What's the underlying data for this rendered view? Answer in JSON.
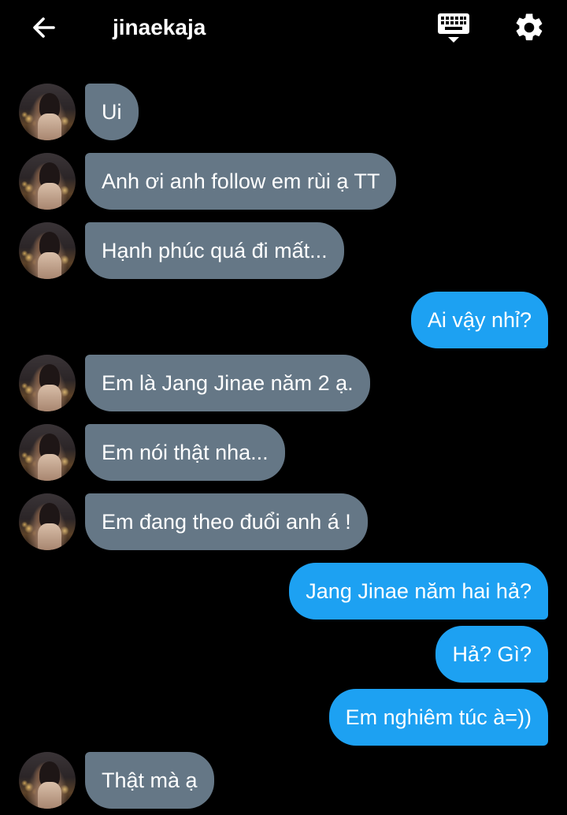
{
  "header": {
    "title": "jinaekaja",
    "back_icon": "arrow-left-icon",
    "keyboard_icon": "keyboard-icon",
    "settings_icon": "gear-icon"
  },
  "colors": {
    "incoming_bubble": "#657786",
    "outgoing_bubble": "#1da1f2",
    "background": "#000000"
  },
  "messages": [
    {
      "from": "them",
      "text": "Ui"
    },
    {
      "from": "them",
      "text": "Anh ơi anh follow em rùi ạ TT"
    },
    {
      "from": "them",
      "text": "Hạnh phúc quá đi mất..."
    },
    {
      "from": "me",
      "text": "Ai vậy nhỉ?"
    },
    {
      "from": "them",
      "text": "Em là Jang Jinae năm 2 ạ."
    },
    {
      "from": "them",
      "text": "Em nói thật nha..."
    },
    {
      "from": "them",
      "text": "Em đang theo đuổi anh á !"
    },
    {
      "from": "me",
      "text": "Jang Jinae năm hai hả?"
    },
    {
      "from": "me",
      "text": "Hả? Gì?"
    },
    {
      "from": "me",
      "text": "Em nghiêm túc à=))"
    },
    {
      "from": "them",
      "text": "Thật mà ạ"
    }
  ]
}
